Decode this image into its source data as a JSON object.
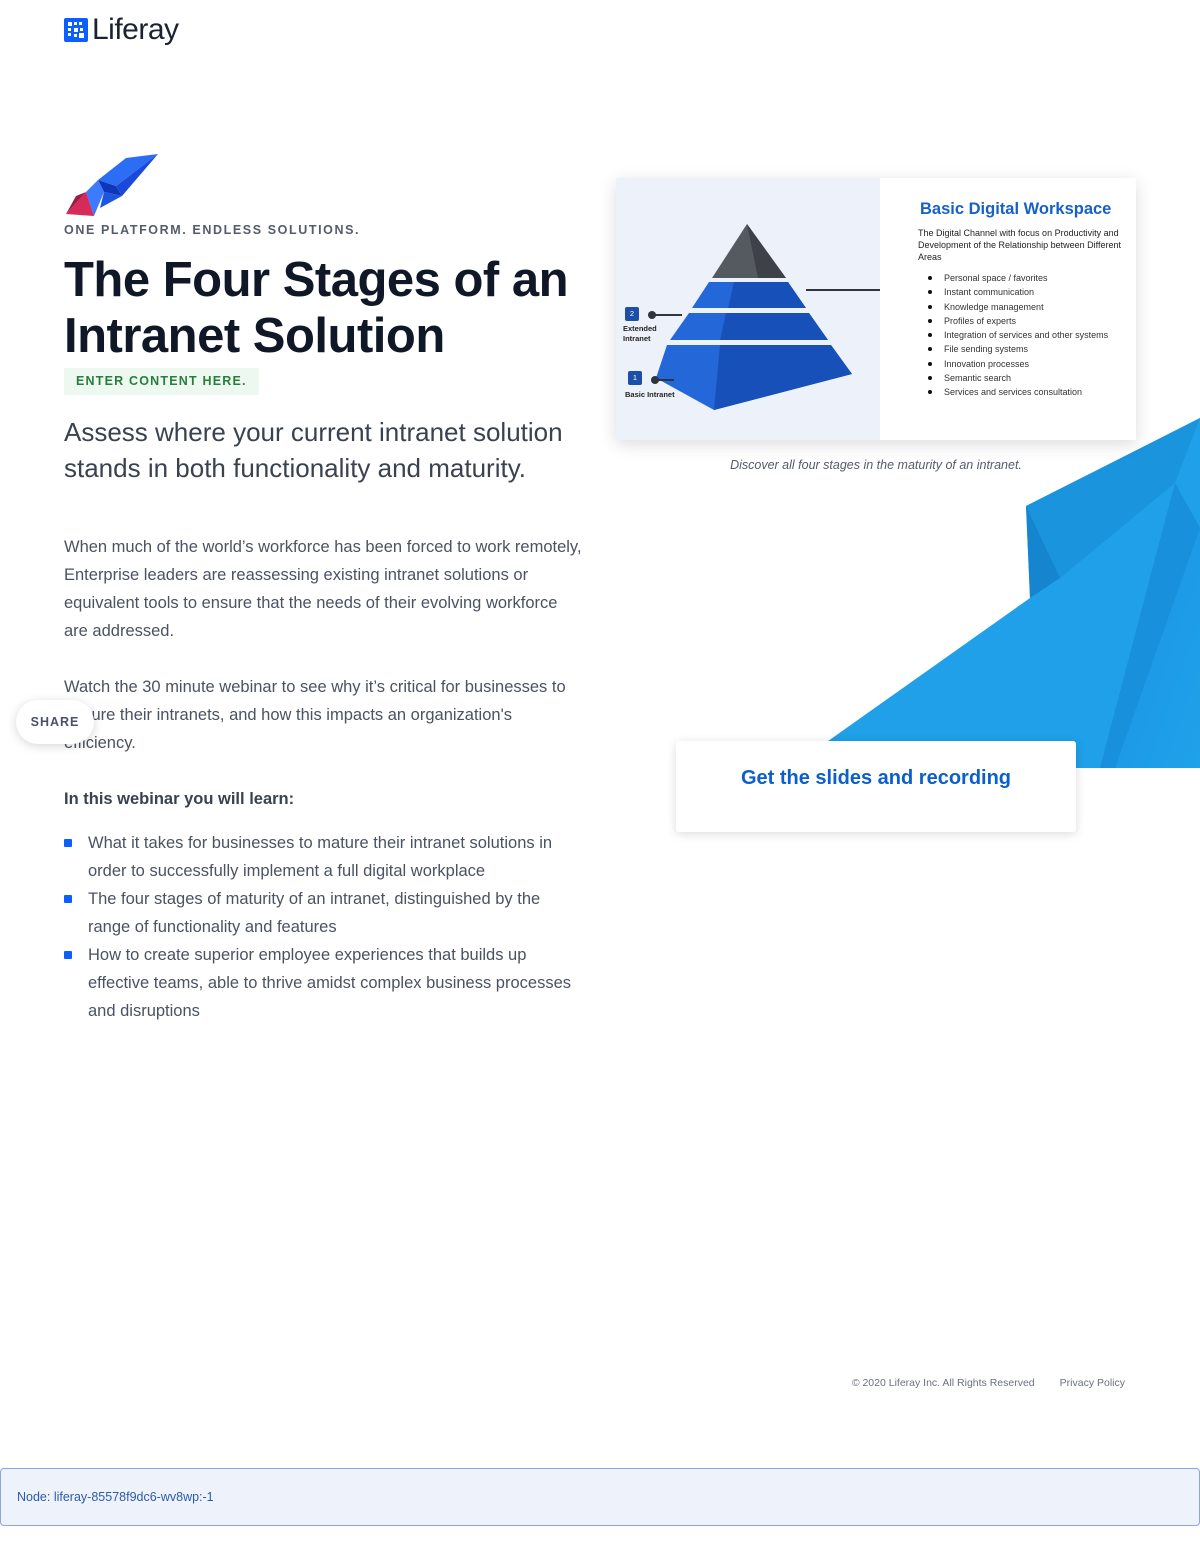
{
  "brand": {
    "name": "Liferay",
    "color": "#0b5fff"
  },
  "hero": {
    "eyebrow": "ONE PLATFORM. ENDLESS SOLUTIONS.",
    "headline": "The Four Stages of an Intranet Solution",
    "tag": "ENTER CONTENT HERE.",
    "subheadline": "Assess where your current intranet solution stands in both functionality and maturity."
  },
  "body": {
    "p1": "When much of the world’s workforce has been forced to work remotely, Enterprise leaders are reassessing existing intranet solutions or equivalent tools to ensure that the needs of their evolving workforce are addressed.",
    "p2": "Watch the 30 minute webinar to see why it’s critical for businesses to mature their intranets, and how this impacts an organization's efficiency.",
    "learn_heading": "In this webinar you will learn:",
    "learn_items": [
      "What it takes for businesses to mature their intranet solutions in order to successfully implement a full digital workplace",
      "The four stages of maturity of an intranet, distinguished by the range of functionality and features",
      "How to create superior employee experiences that builds up effective teams, able to thrive amidst complex business processes and disruptions"
    ]
  },
  "share": {
    "label": "SHARE"
  },
  "slide": {
    "title": "Basic Digital Workspace",
    "description": "The Digital Channel with focus on Productivity and Development of the Relationship between Different Areas",
    "features": [
      "Personal space / favorites",
      "Instant communication",
      "Knowledge management",
      "Profiles of experts",
      "Integration of services and other systems",
      "File sending systems",
      "Innovation processes",
      "Semantic search",
      "Services and services consultation"
    ],
    "stage2_number": "2",
    "stage2_label": "Extended Intranet",
    "stage1_number": "1",
    "stage1_label": "Basic Intranet"
  },
  "caption": "Discover all four stages in the maturity of an intranet.",
  "cta": {
    "label": "Get the slides and recording"
  },
  "footer": {
    "copyright": "© 2020 Liferay Inc. All Rights Reserved",
    "privacy": "Privacy Policy"
  },
  "node": {
    "text": "Node: liferay-85578f9dc6-wv8wp:-1"
  }
}
